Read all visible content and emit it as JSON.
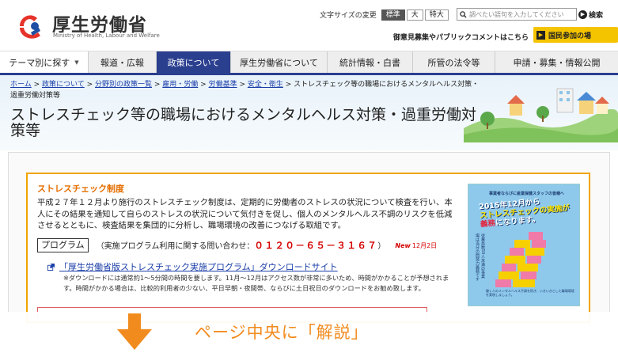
{
  "header": {
    "logo_title": "厚生労働省",
    "logo_subtitle": "Ministry of Health, Labour and Welfare",
    "font_size_label": "文字サイズの変更",
    "font_sizes": [
      "標準",
      "大",
      "特大"
    ],
    "search_placeholder": "調べたい語句を入力してください",
    "search_button": "検索",
    "opinion_link": "御意見募集やパブリックコメントはこちら",
    "kokumin_button": "国民参加の場"
  },
  "nav": {
    "items": [
      "テーマ別に探す",
      "報道・広報",
      "政策について",
      "厚生労働省について",
      "統計情報・白書",
      "所管の法令等",
      "申請・募集・情報公開"
    ],
    "active_index": 2
  },
  "breadcrumb": {
    "links": [
      "ホーム",
      "政策について",
      "分野別の政策一覧",
      "雇用・労働",
      "労働基準",
      "安全・衛生"
    ],
    "current": "ストレスチェック等の職場におけるメンタルヘルス対策・過重労働対策等"
  },
  "page_title": "ストレスチェック等の職場におけるメンタルヘルス対策・過重労働対策等",
  "main": {
    "section_title": "ストレスチェック制度",
    "description": "平成２７年１２月より施行のストレスチェック制度は、定期的に労働者のストレスの状況について検査を行い、本人にその結果を通知して自らのストレスの状況について気付きを促し、個人のメンタルヘルス不調のリスクを低減させるとともに、検査結果を集団的に分析し、職場環境の改善につなげる取組です。",
    "program_label": "プログラム",
    "program_contact": "（実施プログラム利用に関する問い合わせ：",
    "program_phone": "０１２０－６５－３１６７",
    "program_contact_close": "）",
    "new_badge": "New",
    "new_date": "12月2日",
    "download_link": "「厚生労働省版ストレスチェック実施プログラム」ダウンロードサイト",
    "note": "※ダウンロードには通常約1～5分間の時間を要します。11月～12月はアクセス数が非常に多いため、時間がかかることが予想されます。時間がかかる場合は、比較的利用者の少ない、平日早朝・夜間帯、ならびに土日祝日のダウンロードをお勧め致します。"
  },
  "brochure": {
    "line1": "事業者ならびに産業保健スタッフの皆様へ",
    "headline_a": "2015年12月から",
    "headline_b": "ストレスチェックの実施が",
    "headline_c": "義務",
    "headline_d": "になります。",
    "vertical": "従業員数50人未満の事業場は当分の間努力義務です",
    "footer": "働く人のメンタルヘルス不調を防ぎ、いきいきとした職場環境を実現しましょう。"
  },
  "overlay": {
    "text": "ページ中央に「解説」"
  },
  "colors": {
    "nav_active": "#2b3f8f",
    "section_orange": "#e56e00",
    "box_border": "#f0a500",
    "phone_red": "#d40000",
    "link_blue": "#1a3ea8",
    "overlay_orange": "#f28b1e",
    "kokumin_yellow": "#f5c400"
  }
}
